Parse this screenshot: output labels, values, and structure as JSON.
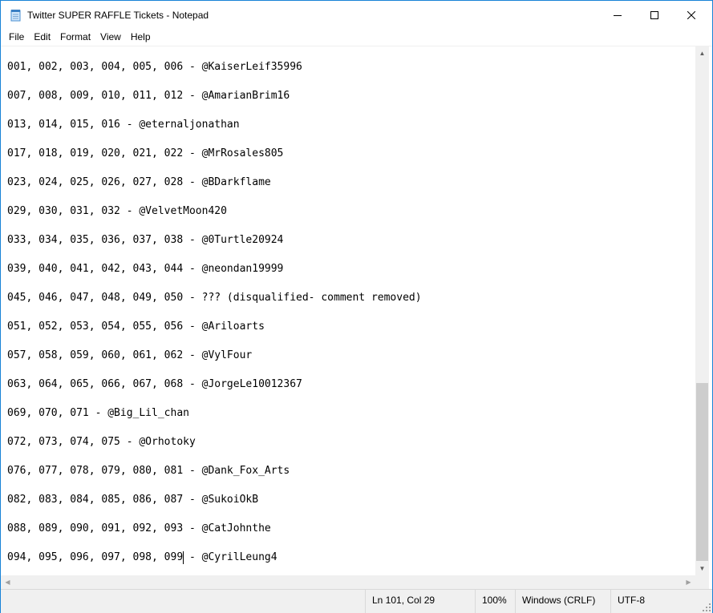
{
  "window": {
    "title": "Twitter SUPER RAFFLE Tickets - Notepad",
    "accent_color": "#1883d7"
  },
  "caption_buttons": {
    "minimize": "minimize-icon",
    "maximize": "maximize-icon",
    "close": "close-icon"
  },
  "menu": {
    "items": [
      "File",
      "Edit",
      "Format",
      "View",
      "Help"
    ]
  },
  "document": {
    "lines": [
      "001, 002, 003, 004, 005, 006 - @KaiserLeif35996",
      "",
      "007, 008, 009, 010, 011, 012 - @AmarianBrim16",
      "",
      "013, 014, 015, 016 - @eternaljonathan",
      "",
      "017, 018, 019, 020, 021, 022 - @MrRosales805",
      "",
      "023, 024, 025, 026, 027, 028 - @BDarkflame",
      "",
      "029, 030, 031, 032 - @VelvetMoon420",
      "",
      "033, 034, 035, 036, 037, 038 - @0Turtle20924",
      "",
      "039, 040, 041, 042, 043, 044 - @neondan19999",
      "",
      "045, 046, 047, 048, 049, 050 - ??? (disqualified- comment removed)",
      "",
      "051, 052, 053, 054, 055, 056 - @Ariloarts",
      "",
      "057, 058, 059, 060, 061, 062 - @VylFour",
      "",
      "063, 064, 065, 066, 067, 068 - @JorgeLe10012367",
      "",
      "069, 070, 071 - @Big_Lil_chan",
      "",
      "072, 073, 074, 075 - @Orhotoky",
      "",
      "076, 077, 078, 079, 080, 081 - @Dank_Fox_Arts",
      "",
      "082, 083, 084, 085, 086, 087 - @SukoiOkB",
      "",
      "088, 089, 090, 091, 092, 093 - @CatJohnthe",
      "",
      "094, 095, 096, 097, 098, 099 - @CyrilLeung4"
    ]
  },
  "status": {
    "position": "Ln 101, Col 29",
    "zoom": "100%",
    "line_ending": "Windows (CRLF)",
    "encoding": "UTF-8"
  }
}
